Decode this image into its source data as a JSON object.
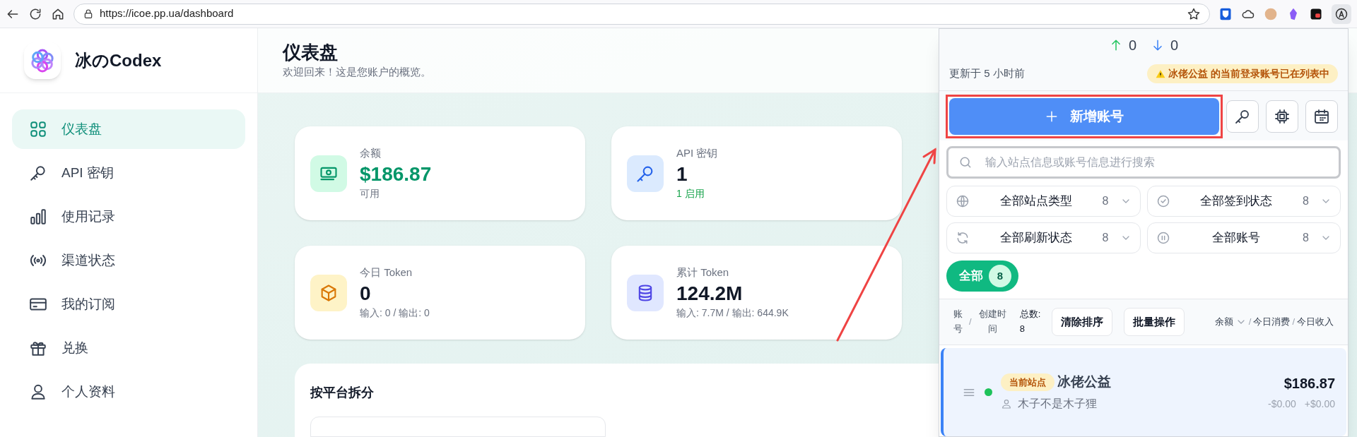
{
  "browser": {
    "url": "https://icoe.pp.ua/dashboard"
  },
  "sidebar": {
    "brand": "冰のCodex",
    "items": [
      {
        "label": "仪表盘",
        "kind": "grid",
        "selected": true
      },
      {
        "label": "API 密钥",
        "kind": "key",
        "selected": false
      },
      {
        "label": "使用记录",
        "kind": "bars",
        "selected": false
      },
      {
        "label": "渠道状态",
        "kind": "signal",
        "selected": false
      },
      {
        "label": "我的订阅",
        "kind": "card",
        "selected": false
      },
      {
        "label": "兑换",
        "kind": "gift",
        "selected": false
      },
      {
        "label": "个人资料",
        "kind": "user",
        "selected": false
      }
    ]
  },
  "header": {
    "title": "仪表盘",
    "subtitle": "欢迎回来！这是您账户的概览。"
  },
  "stats": [
    {
      "kind": "money",
      "label": "余额",
      "value": "$186.87",
      "sub": "可用"
    },
    {
      "kind": "key",
      "label": "API 密钥",
      "value": "1",
      "sub": "1 启用"
    },
    {
      "kind": "box",
      "label": "今日 Token",
      "value": "0",
      "sub": "输入: 0 / 输出: 0"
    },
    {
      "kind": "db",
      "label": "累计 Token",
      "value": "124.2M",
      "sub": "输入: 7.7M / 输出: 644.9K"
    }
  ],
  "platform_section": {
    "title": "按平台拆分"
  },
  "popup": {
    "up": "0",
    "down": "0",
    "updated": "更新于 5 小时前",
    "warning": "冰佬公益 的当前登录账号已在列表中",
    "add_button": "新增账号",
    "search": {
      "placeholder": "输入站点信息或账号信息进行搜索"
    },
    "filters": [
      {
        "kind": "globe",
        "label": "全部站点类型",
        "count": "8"
      },
      {
        "kind": "check",
        "label": "全部签到状态",
        "count": "8"
      },
      {
        "kind": "refresh",
        "label": "全部刷新状态",
        "count": "8"
      },
      {
        "kind": "pause",
        "label": "全部账号",
        "count": "8"
      }
    ],
    "tabs": [
      {
        "label": "全部",
        "count": "8",
        "selected": true
      }
    ],
    "sort": {
      "separator": "/",
      "account": "账号",
      "created": "创建时间",
      "total_label": "总数:",
      "total": "8",
      "buttons": [
        "清除排序",
        "批量操作"
      ],
      "columns": [
        "余额",
        "今日消费",
        "今日收入"
      ]
    },
    "accounts": [
      {
        "badge": "当前站点",
        "name": "冰佬公益",
        "user": "木子不是木子狸",
        "balance": "$186.87",
        "spend": "-$0.00",
        "income": "+$0.00",
        "color": "#1ec25a",
        "selected": true
      }
    ]
  }
}
